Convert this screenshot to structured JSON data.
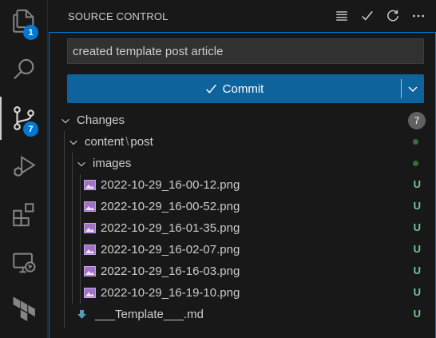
{
  "activity_bar": {
    "explorer_badge": "1",
    "scm_badge": "7",
    "items": [
      {
        "name": "explorer-icon"
      },
      {
        "name": "search-icon"
      },
      {
        "name": "source-control-icon"
      },
      {
        "name": "run-debug-icon"
      },
      {
        "name": "extensions-icon"
      },
      {
        "name": "remote-explorer-icon"
      },
      {
        "name": "terraform-icon"
      }
    ]
  },
  "header": {
    "title": "SOURCE CONTROL",
    "actions": [
      "list-view-icon",
      "commit-check-icon",
      "refresh-icon",
      "more-icon"
    ]
  },
  "commit": {
    "message": "created template post article",
    "button_label": "Commit"
  },
  "changes": {
    "label": "Changes",
    "count": "7",
    "folder": {
      "path_part1": "content",
      "path_sep": "\\",
      "path_part2": "post"
    },
    "subfolder": "images",
    "files": [
      {
        "name": "2022-10-29_16-00-12.png",
        "status": "U"
      },
      {
        "name": "2022-10-29_16-00-52.png",
        "status": "U"
      },
      {
        "name": "2022-10-29_16-01-35.png",
        "status": "U"
      },
      {
        "name": "2022-10-29_16-02-07.png",
        "status": "U"
      },
      {
        "name": "2022-10-29_16-16-03.png",
        "status": "U"
      },
      {
        "name": "2022-10-29_16-19-10.png",
        "status": "U"
      }
    ],
    "md_file": {
      "name": "___Template___.md",
      "status": "U"
    }
  },
  "colors": {
    "accent": "#0078d4",
    "commit_button": "#0e639c",
    "untracked": "#73c991",
    "image_icon": "#a074c4"
  }
}
